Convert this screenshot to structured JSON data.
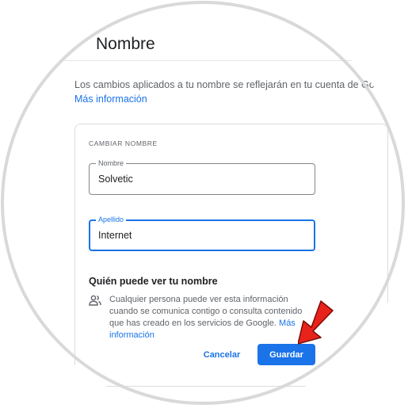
{
  "header": {
    "title": "Nombre"
  },
  "intro": {
    "text": "Los cambios aplicados a tu nombre se reflejarán en tu cuenta de Google.",
    "link": "Más información"
  },
  "form": {
    "section_label": "CAMBIAR NOMBRE",
    "first_name": {
      "label": "Nombre",
      "value": "Solvetic"
    },
    "last_name": {
      "label": "Apellido",
      "value": "Internet"
    }
  },
  "visibility": {
    "title": "Quién puede ver tu nombre",
    "text": "Cualquier persona puede ver esta información cuando se comunica contigo o consulta contenido que has creado en los servicios de Google.",
    "link": "Más información",
    "icon": "people-icon"
  },
  "actions": {
    "cancel": "Cancelar",
    "save": "Guardar"
  },
  "colors": {
    "accent": "#1a73e8",
    "annotation_arrow": "#e8231b"
  }
}
